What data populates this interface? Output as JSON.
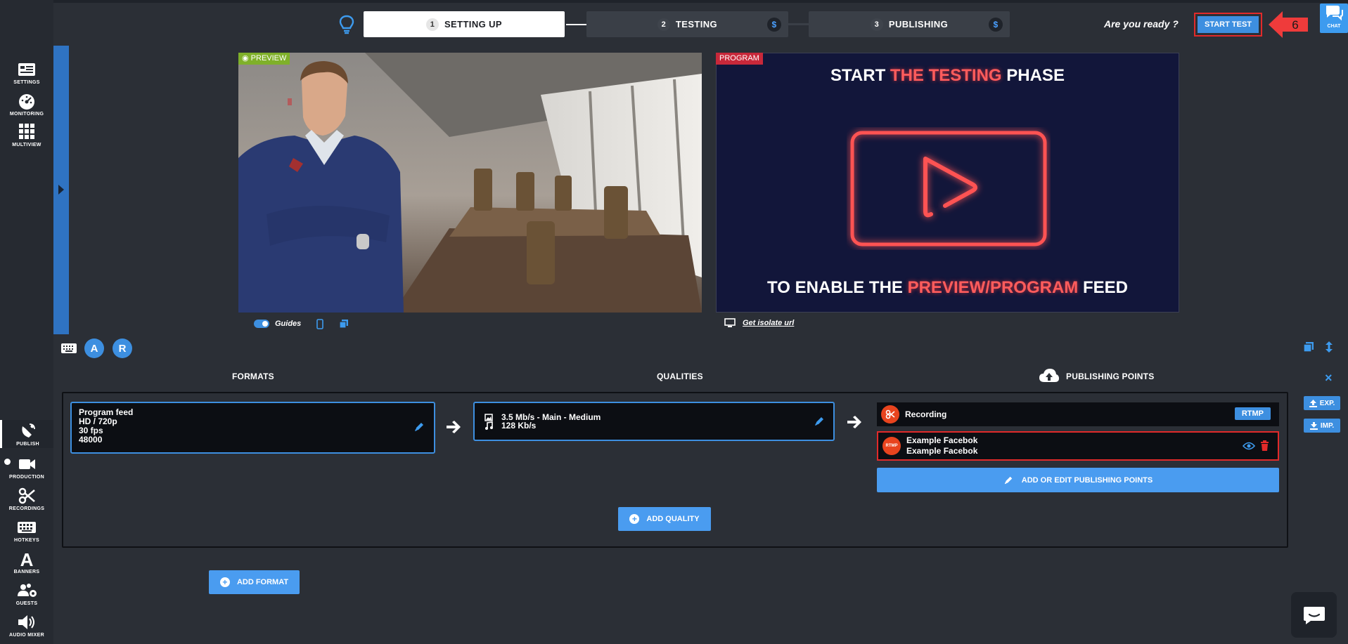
{
  "steps": [
    {
      "num": "1",
      "label": "SETTING UP"
    },
    {
      "num": "2",
      "label": "TESTING",
      "coin": "$"
    },
    {
      "num": "3",
      "label": "PUBLISHING",
      "coin": "$"
    }
  ],
  "header": {
    "ready_text": "Are you ready ?",
    "start_test_label": "START TEST",
    "annotation_number": "6",
    "chat_label": "CHAT"
  },
  "sidebar": {
    "items": [
      {
        "label": "SETTINGS"
      },
      {
        "label": "MONITORING"
      },
      {
        "label": "MULTIVIEW"
      },
      {
        "label": "PUBLISH"
      },
      {
        "label": "PRODUCTION"
      },
      {
        "label": "RECORDINGS"
      },
      {
        "label": "HOTKEYS"
      },
      {
        "label": "BANNERS"
      },
      {
        "label": "GUESTS"
      },
      {
        "label": "AUDIO MIXER"
      }
    ]
  },
  "preview": {
    "tag": "PREVIEW",
    "guides_label": "Guides"
  },
  "program": {
    "tag": "PROGRAM",
    "title_start": "START ",
    "title_highlight": "THE TESTING",
    "title_end": " PHASE",
    "sub_start": "TO ENABLE THE ",
    "sub_highlight": "PREVIEW/PROGRAM",
    "sub_end": " FEED",
    "isolate_link": "Get isolate url"
  },
  "tools": {
    "audio_a": "A",
    "audio_r": "R"
  },
  "publish": {
    "formats_header": "FORMATS",
    "qualities_header": "QUALITIES",
    "points_header": "PUBLISHING POINTS",
    "format": {
      "line1": "Program feed",
      "line2": "HD / 720p",
      "line3": "30 fps",
      "line4": "48000"
    },
    "quality": {
      "video": "3.5 Mb/s  -  Main  -  Medium",
      "audio": "128 Kb/s"
    },
    "points": [
      {
        "name": "Recording",
        "badge": "RTMP"
      },
      {
        "name": "Example Facebok",
        "subname": "Example Facebok",
        "icon_text": "RTMP"
      }
    ],
    "add_edit_label": "ADD OR EDIT PUBLISHING POINTS",
    "add_quality_label": "ADD QUALITY",
    "add_format_label": "ADD FORMAT"
  },
  "right_panel": {
    "close": "×",
    "exp_label": "EXP.",
    "imp_label": "IMP."
  },
  "colors": {
    "accent": "#3d8fe0",
    "alert": "#e22a2a",
    "preview_tag": "#7fb02a",
    "program_tag": "#c8283a",
    "publish_icon": "#e8441e"
  }
}
